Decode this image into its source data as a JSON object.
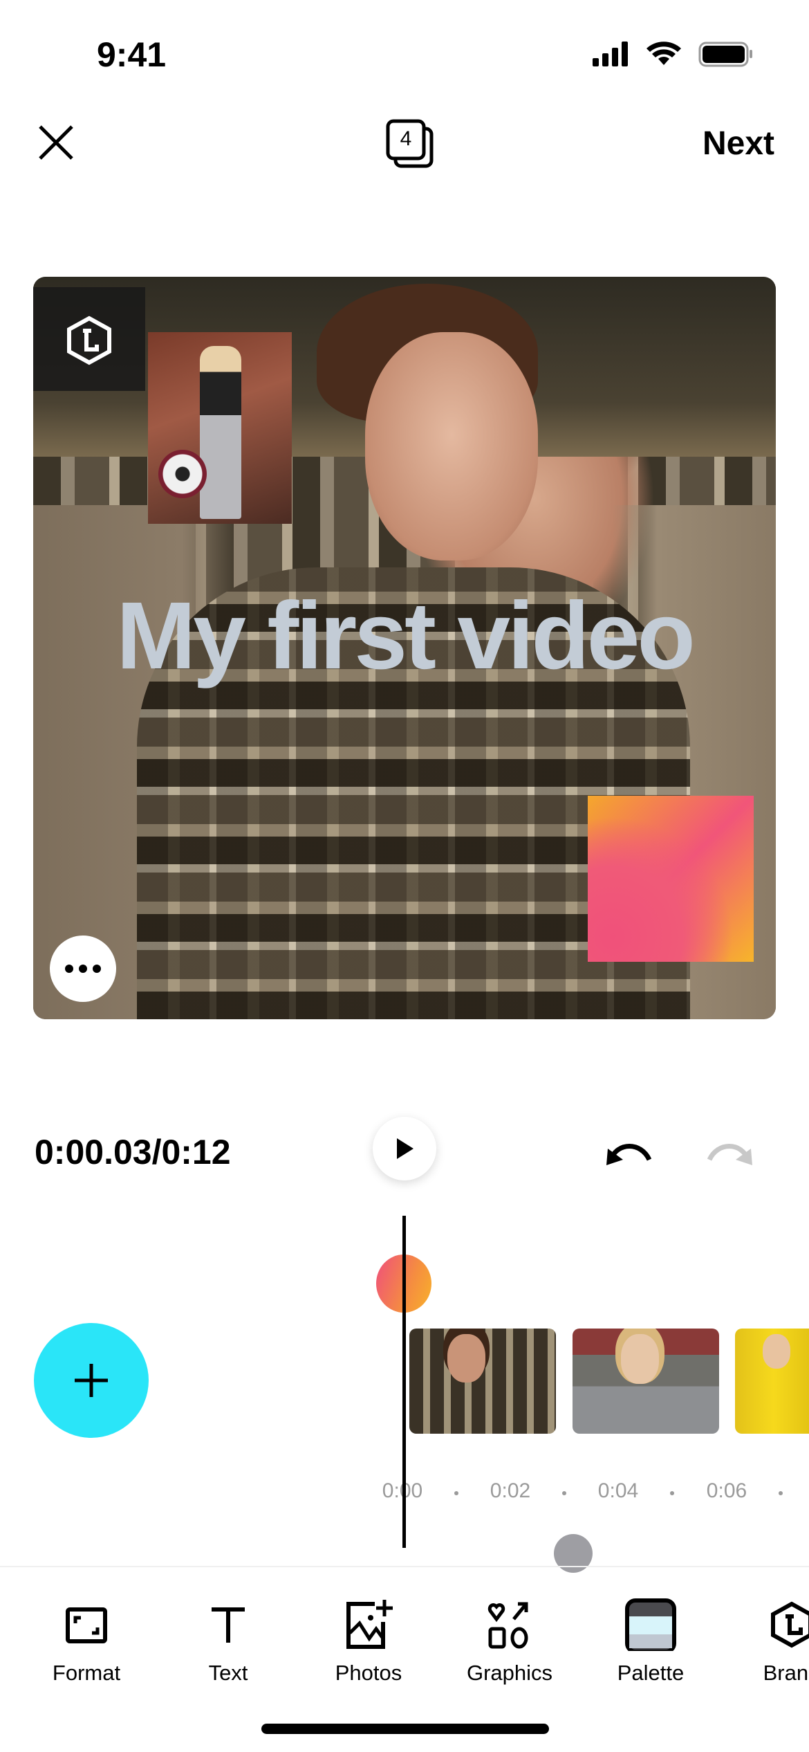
{
  "status_bar": {
    "time": "9:41"
  },
  "top_bar": {
    "close_icon": "close-icon",
    "pages_count": "4",
    "next_label": "Next"
  },
  "canvas": {
    "title_text": "My first video",
    "gradient_colors": [
      "#f5a72c",
      "#f15579",
      "#f7b52a"
    ]
  },
  "playback": {
    "current_time": "0:00.03/0:12",
    "undo_enabled": true,
    "redo_enabled": false
  },
  "timeline": {
    "ticks": [
      "0:00",
      "0:02",
      "0:04",
      "0:06"
    ],
    "accent": "#2ae5f8"
  },
  "toolbar": {
    "items": [
      {
        "label": "Format",
        "icon": "format-icon"
      },
      {
        "label": "Text",
        "icon": "text-icon"
      },
      {
        "label": "Photos",
        "icon": "photos-add-icon"
      },
      {
        "label": "Graphics",
        "icon": "graphics-icon"
      },
      {
        "label": "Palette",
        "icon": "palette-icon"
      },
      {
        "label": "Brand",
        "icon": "brand-logo-icon"
      }
    ]
  }
}
